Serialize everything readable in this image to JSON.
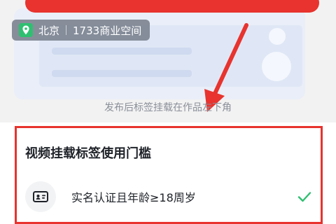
{
  "location_tag": {
    "city": "北京",
    "place": "1733商业空间",
    "icon": "location-pin-icon"
  },
  "caption": "发布后标签挂载在作品左下角",
  "panel": {
    "title": "视频挂载标签使用门槛",
    "requirements": [
      {
        "label": "实名认证且年龄≥18周岁",
        "icon": "id-card-icon",
        "status_icon": "check-icon"
      }
    ]
  },
  "colors": {
    "highlight": "#e8332e",
    "pin_green": "#2fbf71",
    "check_green": "#2fbf71",
    "caption_gray": "#8a8f99"
  }
}
